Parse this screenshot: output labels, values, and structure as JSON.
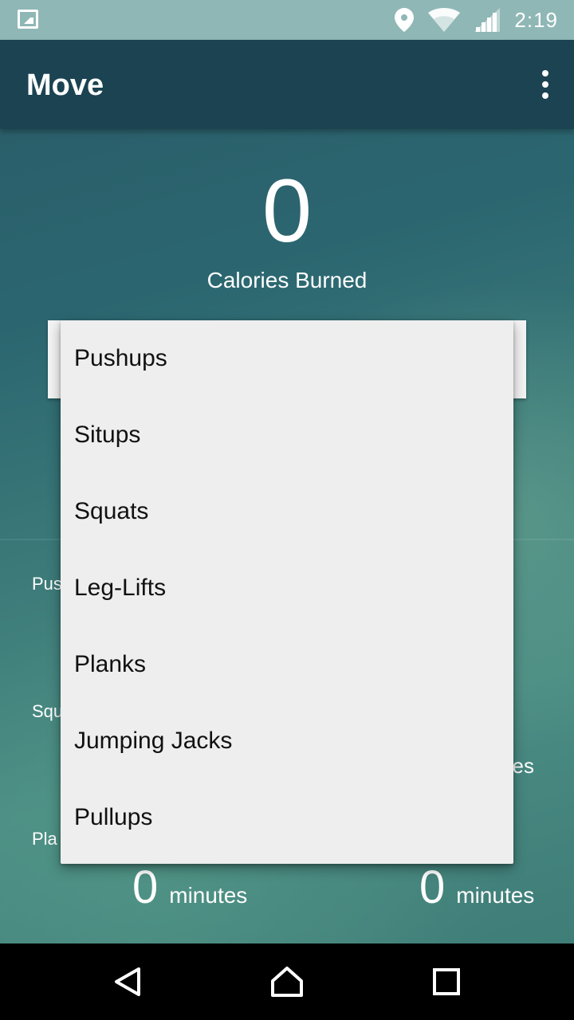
{
  "status_bar": {
    "time": "2:19",
    "icons": [
      "image-icon",
      "location-icon",
      "wifi-icon",
      "cell-signal-icon"
    ]
  },
  "app_bar": {
    "title": "Move",
    "overflow_icon": "more-vert-icon"
  },
  "hero": {
    "calories_value": "0",
    "calories_label": "Calories Burned"
  },
  "dropdown": {
    "items": [
      "Pushups",
      "Situps",
      "Squats",
      "Leg-Lifts",
      "Planks",
      "Jumping Jacks",
      "Pullups"
    ]
  },
  "background_stats": {
    "label_1": "Pus",
    "label_2": "Squ",
    "label_3": "Pla",
    "right_suffix": "es",
    "left_minutes_value": "0",
    "left_minutes_unit": "minutes",
    "right_minutes_value": "0",
    "right_minutes_unit": "minutes"
  },
  "nav_bar": {
    "icons": [
      "back-icon",
      "home-icon",
      "recents-icon"
    ]
  },
  "colors": {
    "status_bar": "#8fb7b6",
    "app_bar": "#1b4352",
    "dropdown_bg": "#eeeeee"
  }
}
